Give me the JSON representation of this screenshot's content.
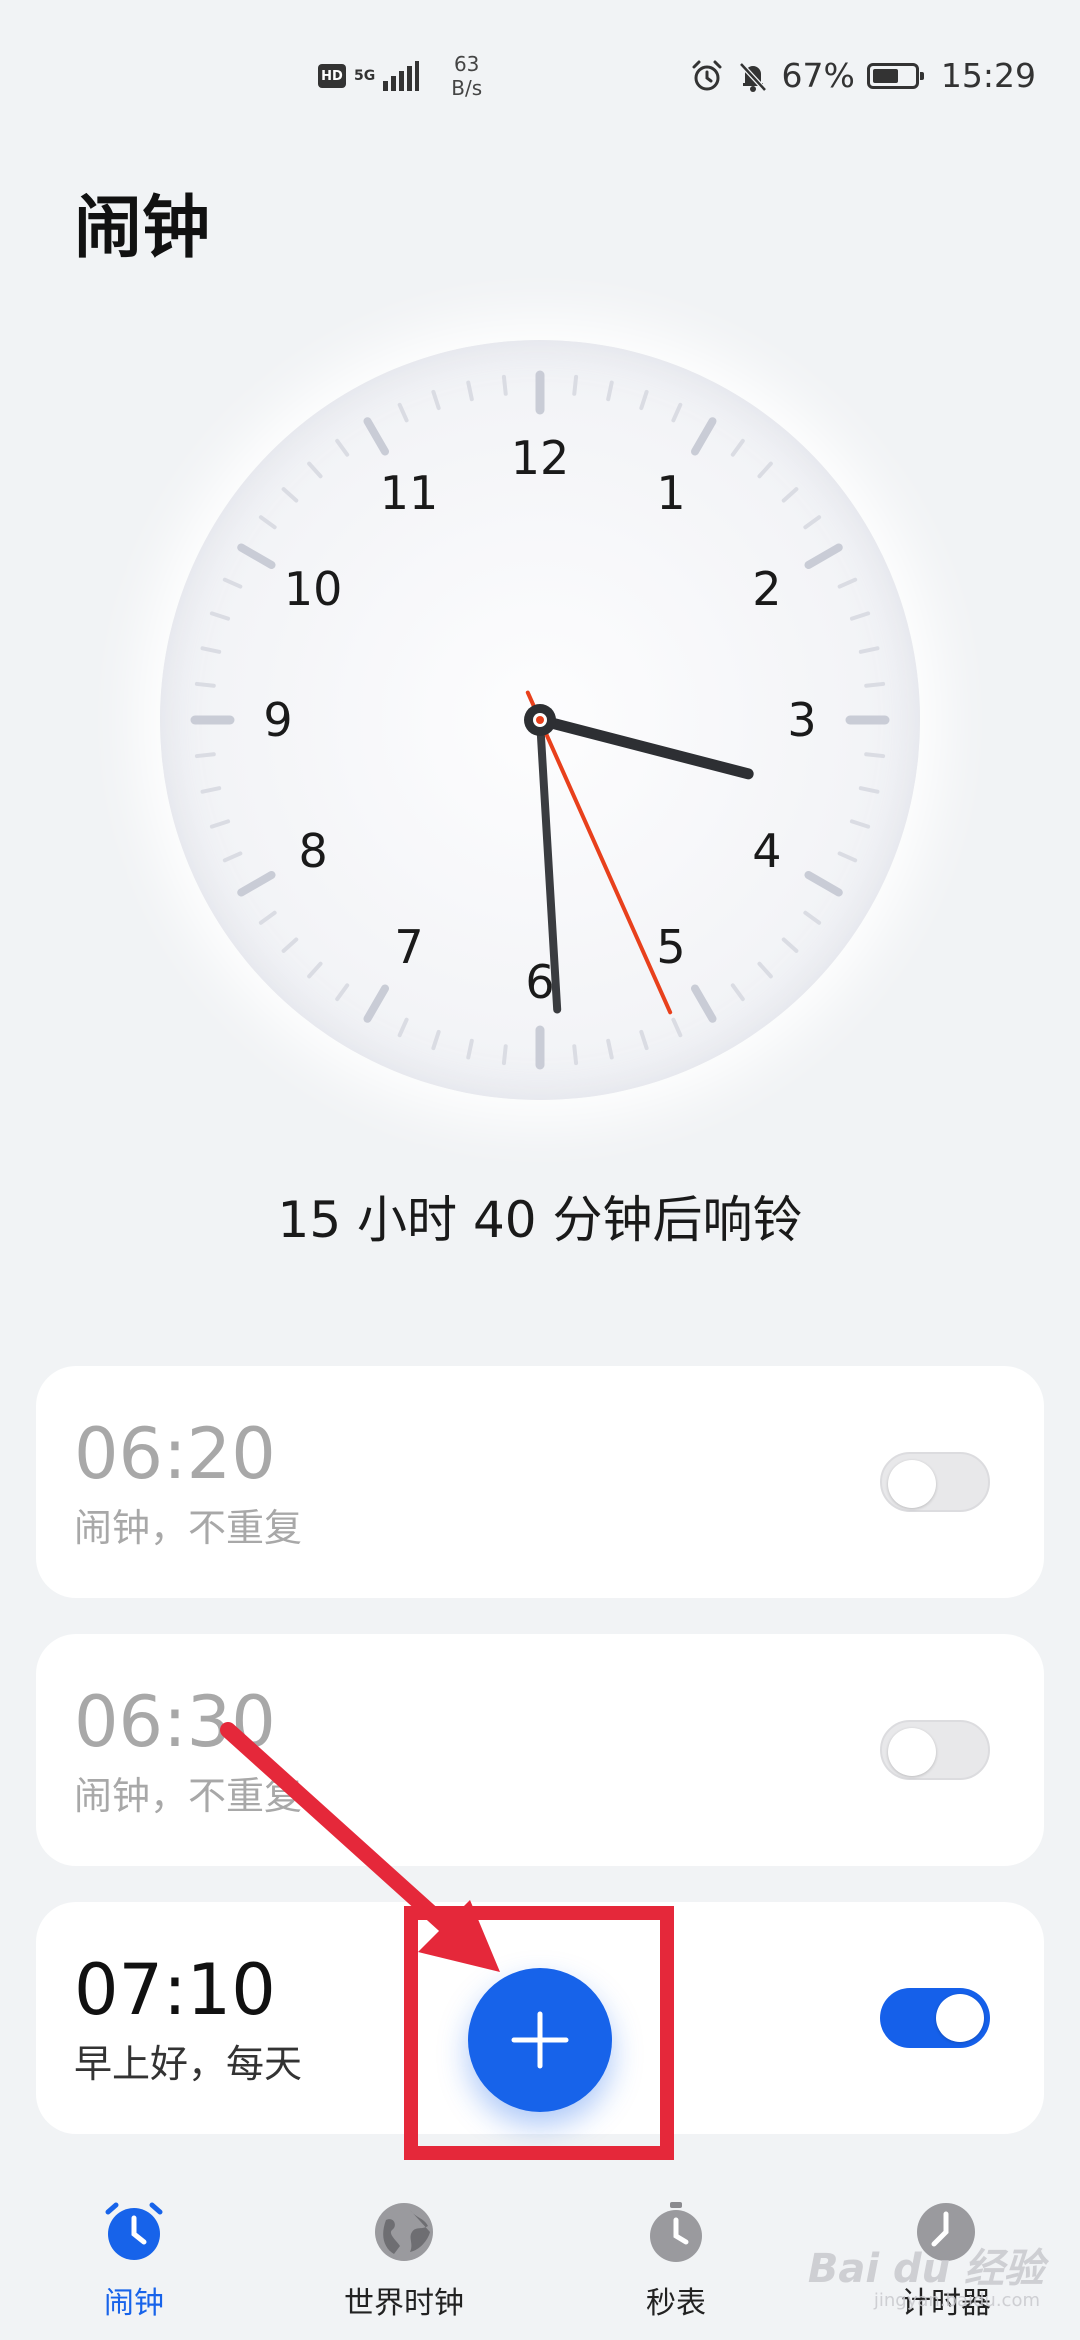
{
  "status_bar": {
    "hd": "HD",
    "signal": "5G",
    "net_speed_value": "63",
    "net_speed_unit": "B/s",
    "battery_percent": "67%",
    "battery_level": 0.67,
    "time": "15:29"
  },
  "page": {
    "title": "闹钟"
  },
  "clock": {
    "numerals": [
      "12",
      "1",
      "2",
      "3",
      "4",
      "5",
      "6",
      "7",
      "8",
      "9",
      "10",
      "11"
    ],
    "hour": 3,
    "minute": 29,
    "second": 26
  },
  "ring_text": "15 小时 40 分钟后响铃",
  "alarms": [
    {
      "time": "06:20",
      "label": "闹钟，不重复",
      "enabled": false
    },
    {
      "time": "06:30",
      "label": "闹钟，不重复",
      "enabled": false
    },
    {
      "time": "07:10",
      "label": "早上好，每天",
      "enabled": true
    }
  ],
  "fab": {
    "icon": "plus-icon"
  },
  "nav": [
    {
      "label": "闹钟",
      "icon": "alarm-clock-icon",
      "active": true
    },
    {
      "label": "世界时钟",
      "icon": "globe-icon",
      "active": false
    },
    {
      "label": "秒表",
      "icon": "stopwatch-icon",
      "active": false
    },
    {
      "label": "计时器",
      "icon": "timer-icon",
      "active": false
    }
  ],
  "watermark": {
    "main": "Bai du 经验",
    "sub": "jingyan.baidu.com"
  },
  "colors": {
    "accent": "#1763ea",
    "annotation": "#e5283a",
    "second_hand": "#e8401c"
  }
}
